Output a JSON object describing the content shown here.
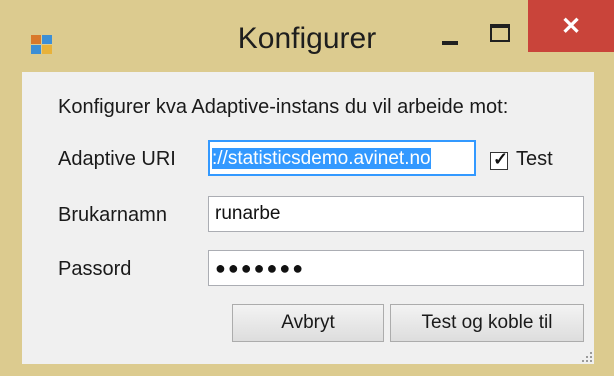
{
  "window": {
    "title": "Konfigurer",
    "close_glyph": "✕",
    "app_icon": "app-icon",
    "colors": {
      "frame": "#dccb8f",
      "close_bg": "#c9443a",
      "client_bg": "#f0f0f0",
      "selection": "#3399ff"
    }
  },
  "form": {
    "instructions": "Konfigurer kva Adaptive-instans du vil arbeide mot:",
    "uri_label": "Adaptive URI",
    "uri_value": "://statisticsdemo.avinet.no",
    "test_label": "Test",
    "test_checked": true,
    "username_label": "Brukarnamn",
    "username_value": "runarbe",
    "password_label": "Passord",
    "password_value": "●●●●●●●"
  },
  "buttons": {
    "cancel": "Avbryt",
    "connect": "Test og koble til"
  }
}
